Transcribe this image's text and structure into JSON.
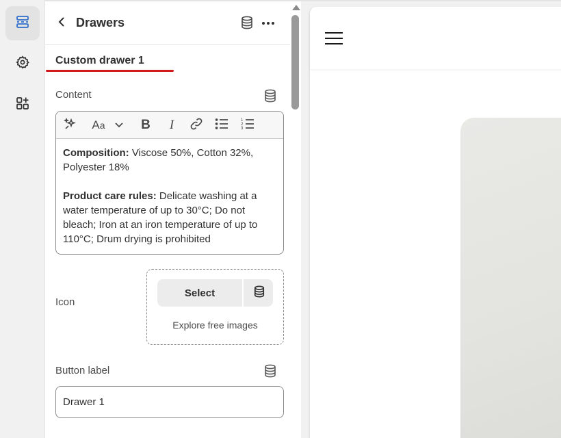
{
  "rail": {
    "items": [
      {
        "icon": "sections-icon",
        "active": true
      },
      {
        "icon": "gear-icon",
        "active": false
      },
      {
        "icon": "apps-add-icon",
        "active": false
      }
    ]
  },
  "header": {
    "title": "Drawers"
  },
  "section": {
    "title": "Custom drawer 1"
  },
  "content": {
    "label": "Content",
    "toolbar": [
      "magic-icon",
      "font-size-icon",
      "chevron-down-icon",
      "bold-icon",
      "italic-icon",
      "link-icon",
      "bullet-list-icon",
      "numbered-list-icon"
    ],
    "p1_bold": "Composition:",
    "p1_text": " Viscose 50%, Cotton 32%, Polyester 18%",
    "p2_bold": "Product care rules:",
    "p2_text": " Delicate washing at a water temperature of up to 30°C; Do not bleach; Iron at an iron temperature of up to 110°C; Drum drying is prohibited"
  },
  "icon_field": {
    "label": "Icon",
    "select_label": "Select",
    "explore_label": "Explore free images"
  },
  "button_label": {
    "label": "Button label",
    "value": "Drawer 1"
  },
  "colors": {
    "accent_underline": "#d11a1a",
    "active_icon": "#2c6ecb"
  }
}
